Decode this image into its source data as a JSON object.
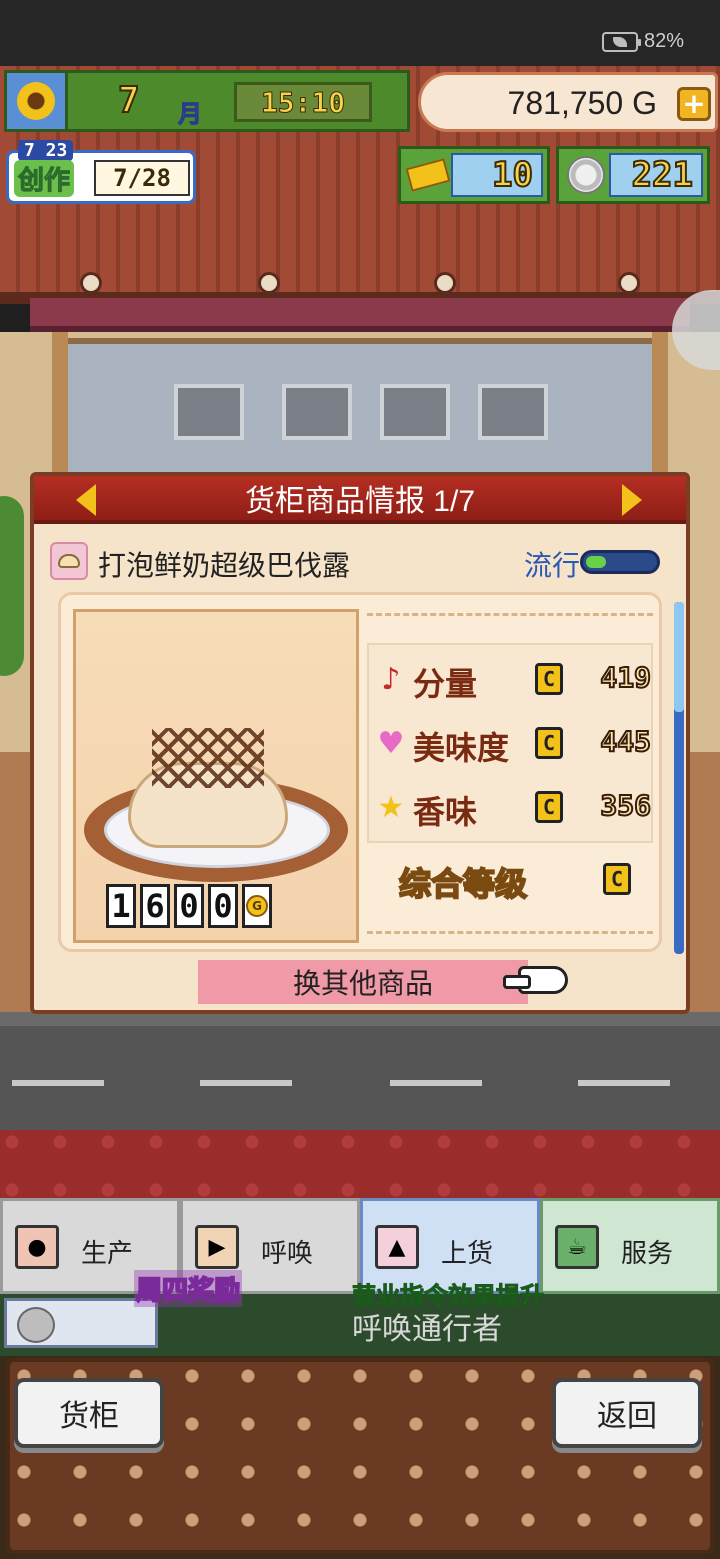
{
  "status_bar": {
    "battery_percent": "82%"
  },
  "hud": {
    "month_number": "7",
    "month_label": "月",
    "time": "15:10",
    "money": "781,750 G",
    "money_add": "+",
    "craft": {
      "date": "7 23",
      "label": "创作",
      "progress": "7/28"
    },
    "tickets": "10",
    "medals": "221"
  },
  "dialog": {
    "title": "货柜商品情报 1/7",
    "product_name": "打泡鲜奶超级巴伐露",
    "trend_label": "流行",
    "trend_level": 0.3,
    "price_digits": [
      "1",
      "6",
      "0",
      "0"
    ],
    "price_unit": "G",
    "stats": [
      {
        "label": "分量",
        "grade": "C",
        "value": "419",
        "icon": "music-note-icon"
      },
      {
        "label": "美味度",
        "grade": "C",
        "value": "445",
        "icon": "heart-icon"
      },
      {
        "label": "香味",
        "grade": "C",
        "value": "356",
        "icon": "star-icon"
      }
    ],
    "overall_label": "综合等级",
    "overall_grade": "C",
    "switch_button": "换其他商品"
  },
  "tabs": [
    {
      "label": "生产",
      "icon": "bread-icon"
    },
    {
      "label": "呼唤",
      "icon": "flag-icon"
    },
    {
      "label": "上货",
      "icon": "cake-icon"
    },
    {
      "label": "服务",
      "icon": "coffee-cup-icon"
    }
  ],
  "info": {
    "text": "呼唤通行者",
    "bonus_label": "周四奖励",
    "boost_label": "营业指令效果提升"
  },
  "buttons": {
    "cabinet": "货柜",
    "back": "返回"
  },
  "colors": {
    "header_red": "#b52e22",
    "panel_cream": "#f5e4c9",
    "gold": "#f2c21a",
    "trend_green": "#6ad04a"
  }
}
